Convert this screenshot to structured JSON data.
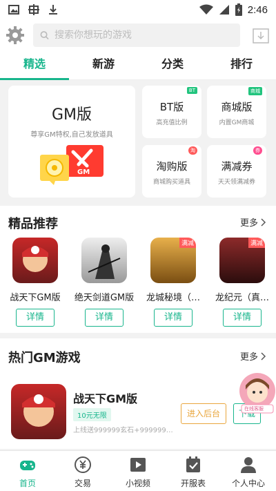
{
  "status_bar": {
    "time": "2:46"
  },
  "search": {
    "placeholder": "搜索你想玩的游戏"
  },
  "tabs": [
    {
      "label": "精选",
      "active": true
    },
    {
      "label": "新游",
      "active": false
    },
    {
      "label": "分类",
      "active": false
    },
    {
      "label": "排行",
      "active": false
    }
  ],
  "categories": {
    "big": {
      "title": "GM版",
      "subtitle": "尊享GM特权,自己发放道具"
    },
    "small": [
      {
        "title": "BT版",
        "subtitle": "高充值比例",
        "badge": "BT"
      },
      {
        "title": "商城版",
        "subtitle": "内置GM商城",
        "badge": "商城"
      },
      {
        "title": "淘购版",
        "subtitle": "商城购买道具",
        "badge": "淘"
      },
      {
        "title": "满减券",
        "subtitle": "天天领满减券",
        "badge": "券"
      }
    ]
  },
  "recommended": {
    "title": "精品推荐",
    "more": "更多",
    "games": [
      {
        "name": "战天下GM版",
        "button": "详情"
      },
      {
        "name": "绝天剑道GM版",
        "button": "详情"
      },
      {
        "name": "龙城秘境（…",
        "button": "详情",
        "tag": "满减"
      },
      {
        "name": "龙纪元（真…",
        "button": "详情",
        "tag": "满减"
      }
    ]
  },
  "hot_gm": {
    "title": "热门GM游戏",
    "more": "更多",
    "item": {
      "name": "战天下GM版",
      "tag": "10元无限",
      "desc": "上线送999999玄石+999999…",
      "btn_backend": "进入后台",
      "btn_download": "下载"
    },
    "customer_service": "在线客服"
  },
  "bottom_nav": [
    {
      "label": "首页",
      "icon": "gamepad-icon",
      "active": true
    },
    {
      "label": "交易",
      "icon": "yen-coin-icon",
      "active": false
    },
    {
      "label": "小视频",
      "icon": "video-play-icon",
      "active": false
    },
    {
      "label": "开服表",
      "icon": "calendar-check-icon",
      "active": false
    },
    {
      "label": "个人中心",
      "icon": "user-icon",
      "active": false
    }
  ],
  "colors": {
    "accent": "#17b58c",
    "warn": "#e9a63c",
    "badge_green": "#22c47e"
  }
}
